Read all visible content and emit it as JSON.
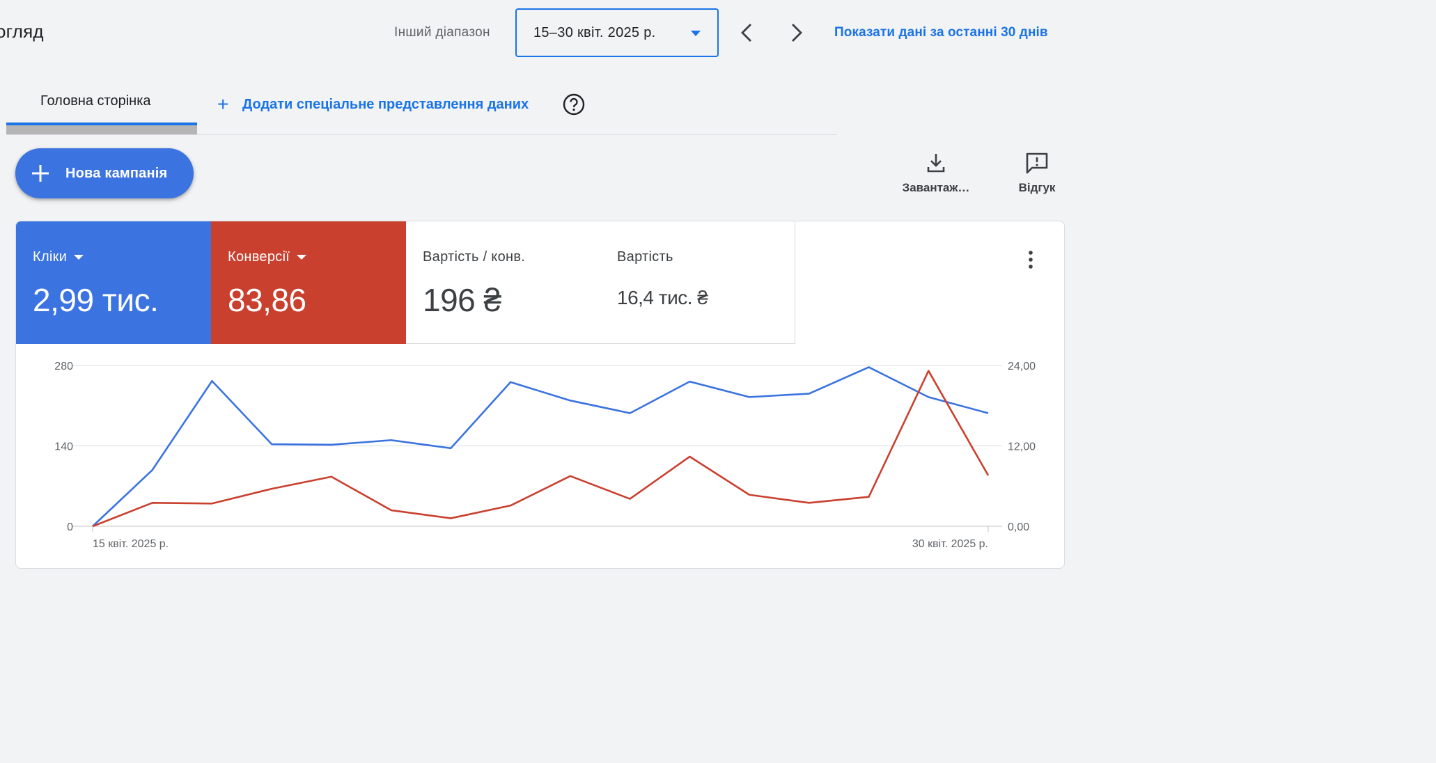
{
  "header": {
    "page_title": "огляд",
    "range_label": "Інший діапазон",
    "date_range": "15–30 квіт. 2025 р.",
    "show_last_30": "Показати дані за останні 30 днів"
  },
  "tabs": {
    "home": "Головна сторінка",
    "add_view": "Додати спеціальне представлення даних"
  },
  "actions": {
    "new_campaign": "Нова кампанія",
    "download": "Завантаж…",
    "feedback": "Відгук"
  },
  "metrics": [
    {
      "name": "Кліки",
      "value": "2,99 тис.",
      "color": "#3b73e0"
    },
    {
      "name": "Конверсії",
      "value": "83,86",
      "color": "#c9402f"
    },
    {
      "name": "Вартість / конв.",
      "value": "196 ₴"
    },
    {
      "name": "Вартість",
      "value": "16,4 тис. ₴"
    }
  ],
  "chart_data": {
    "type": "line",
    "x": [
      "15 квіт. 2025 р.",
      "16",
      "17",
      "18",
      "19",
      "20",
      "21",
      "22",
      "23",
      "24",
      "25",
      "26",
      "27",
      "28",
      "29",
      "30 квіт. 2025 р."
    ],
    "x_tick_labels": [
      "15 квіт. 2025 р.",
      "30 квіт. 2025 р."
    ],
    "series": [
      {
        "name": "Кліки",
        "axis": "left",
        "color": "#3b73e0",
        "values": [
          0,
          98,
          253,
          143,
          142,
          150,
          136,
          251,
          219,
          197,
          252,
          225,
          231,
          277,
          225,
          197
        ]
      },
      {
        "name": "Конверсії",
        "axis": "right",
        "color": "#c9402f",
        "values": [
          0,
          3.5,
          3.4,
          5.6,
          7.4,
          2.4,
          1.2,
          3.1,
          7.5,
          4.1,
          10.4,
          4.7,
          3.5,
          4.4,
          23.2,
          7.6
        ]
      }
    ],
    "y_left": {
      "ticks": [
        "280",
        "140",
        "0"
      ],
      "lim": [
        0,
        280
      ]
    },
    "y_right": {
      "ticks": [
        "24,00",
        "12,00",
        "0,00"
      ],
      "lim": [
        0,
        24
      ]
    },
    "grid": true
  }
}
